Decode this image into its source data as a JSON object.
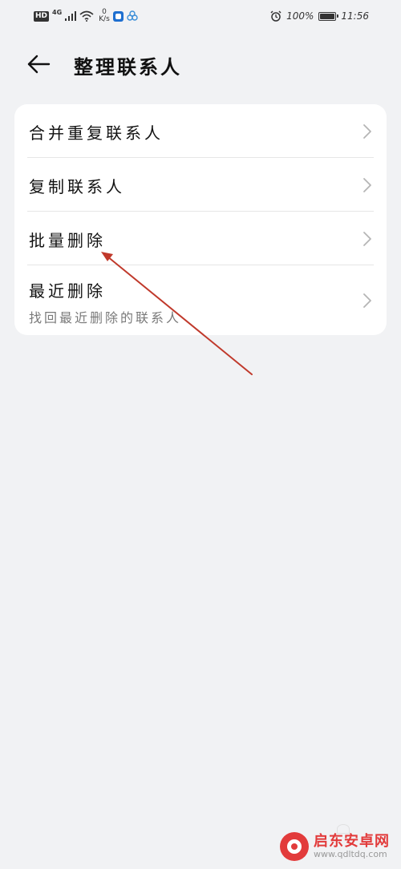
{
  "status_bar": {
    "left": {
      "hd_label": "HD",
      "network_type": "4G",
      "speed_value": "0",
      "speed_unit": "K/s"
    },
    "right": {
      "battery_percent_text": "100%",
      "battery_level": 1.0,
      "time": "11:56"
    }
  },
  "header": {
    "title": "整理联系人"
  },
  "menu": {
    "items": [
      {
        "label": "合并重复联系人"
      },
      {
        "label": "复制联系人"
      },
      {
        "label": "批量删除"
      },
      {
        "label": "最近删除",
        "subtitle": "找回最近删除的联系人"
      }
    ]
  },
  "watermark": {
    "name": "启东安卓网",
    "url": "www.qdltdq.com"
  },
  "colors": {
    "background": "#f1f2f4",
    "card": "#ffffff",
    "annotation_arrow": "#c0392b",
    "watermark_red": "#e23b3b"
  },
  "icons": {
    "back": "arrow-left-icon",
    "chevron": "chevron-right-icon",
    "alarm": "alarm-icon",
    "wifi": "wifi-icon",
    "signal": "signal-icon"
  }
}
